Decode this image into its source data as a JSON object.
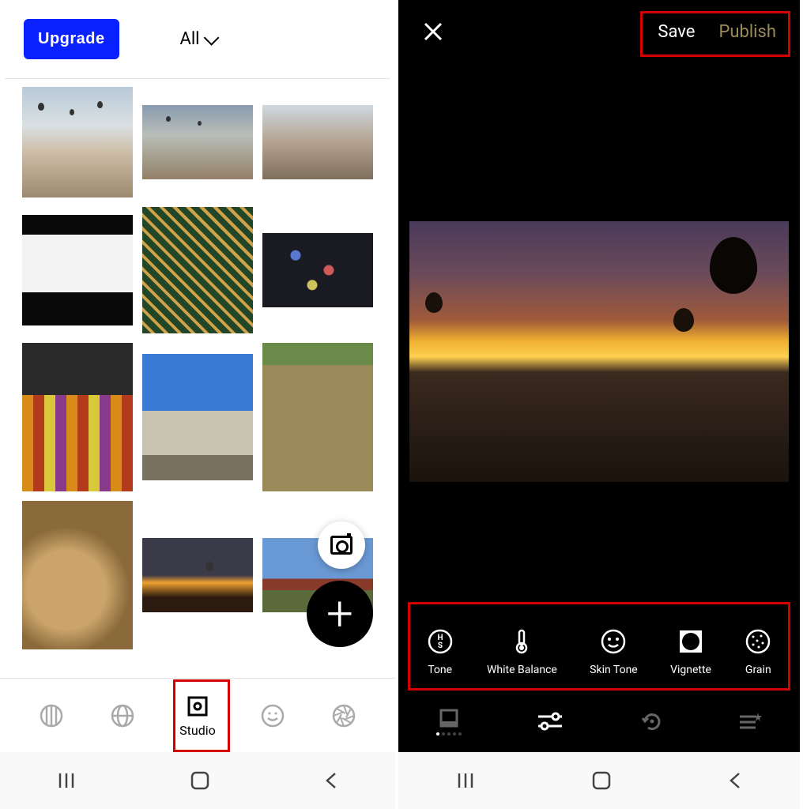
{
  "left": {
    "upgrade_label": "Upgrade",
    "filter_label": "All",
    "tabs": {
      "feed": "",
      "discover": "",
      "studio": "Studio",
      "profile": "",
      "settings": ""
    },
    "fab_camera": "camera",
    "fab_plus": "+",
    "sys_nav": {
      "recents": "|||",
      "home": "○",
      "back": "<"
    }
  },
  "right": {
    "close": "×",
    "save_label": "Save",
    "publish_label": "Publish",
    "tools": [
      {
        "name": "tone",
        "label": "Tone"
      },
      {
        "name": "white-balance",
        "label": "White Balance"
      },
      {
        "name": "skin-tone",
        "label": "Skin Tone"
      },
      {
        "name": "vignette",
        "label": "Vignette"
      },
      {
        "name": "grain",
        "label": "Grain"
      }
    ],
    "bottom_tabs": [
      "presets",
      "adjust",
      "history",
      "recipes"
    ],
    "sys_nav": {
      "recents": "|||",
      "home": "○",
      "back": "<"
    }
  },
  "highlights": {
    "studio_tab": true,
    "save_publish": true,
    "edit_tools": true
  }
}
